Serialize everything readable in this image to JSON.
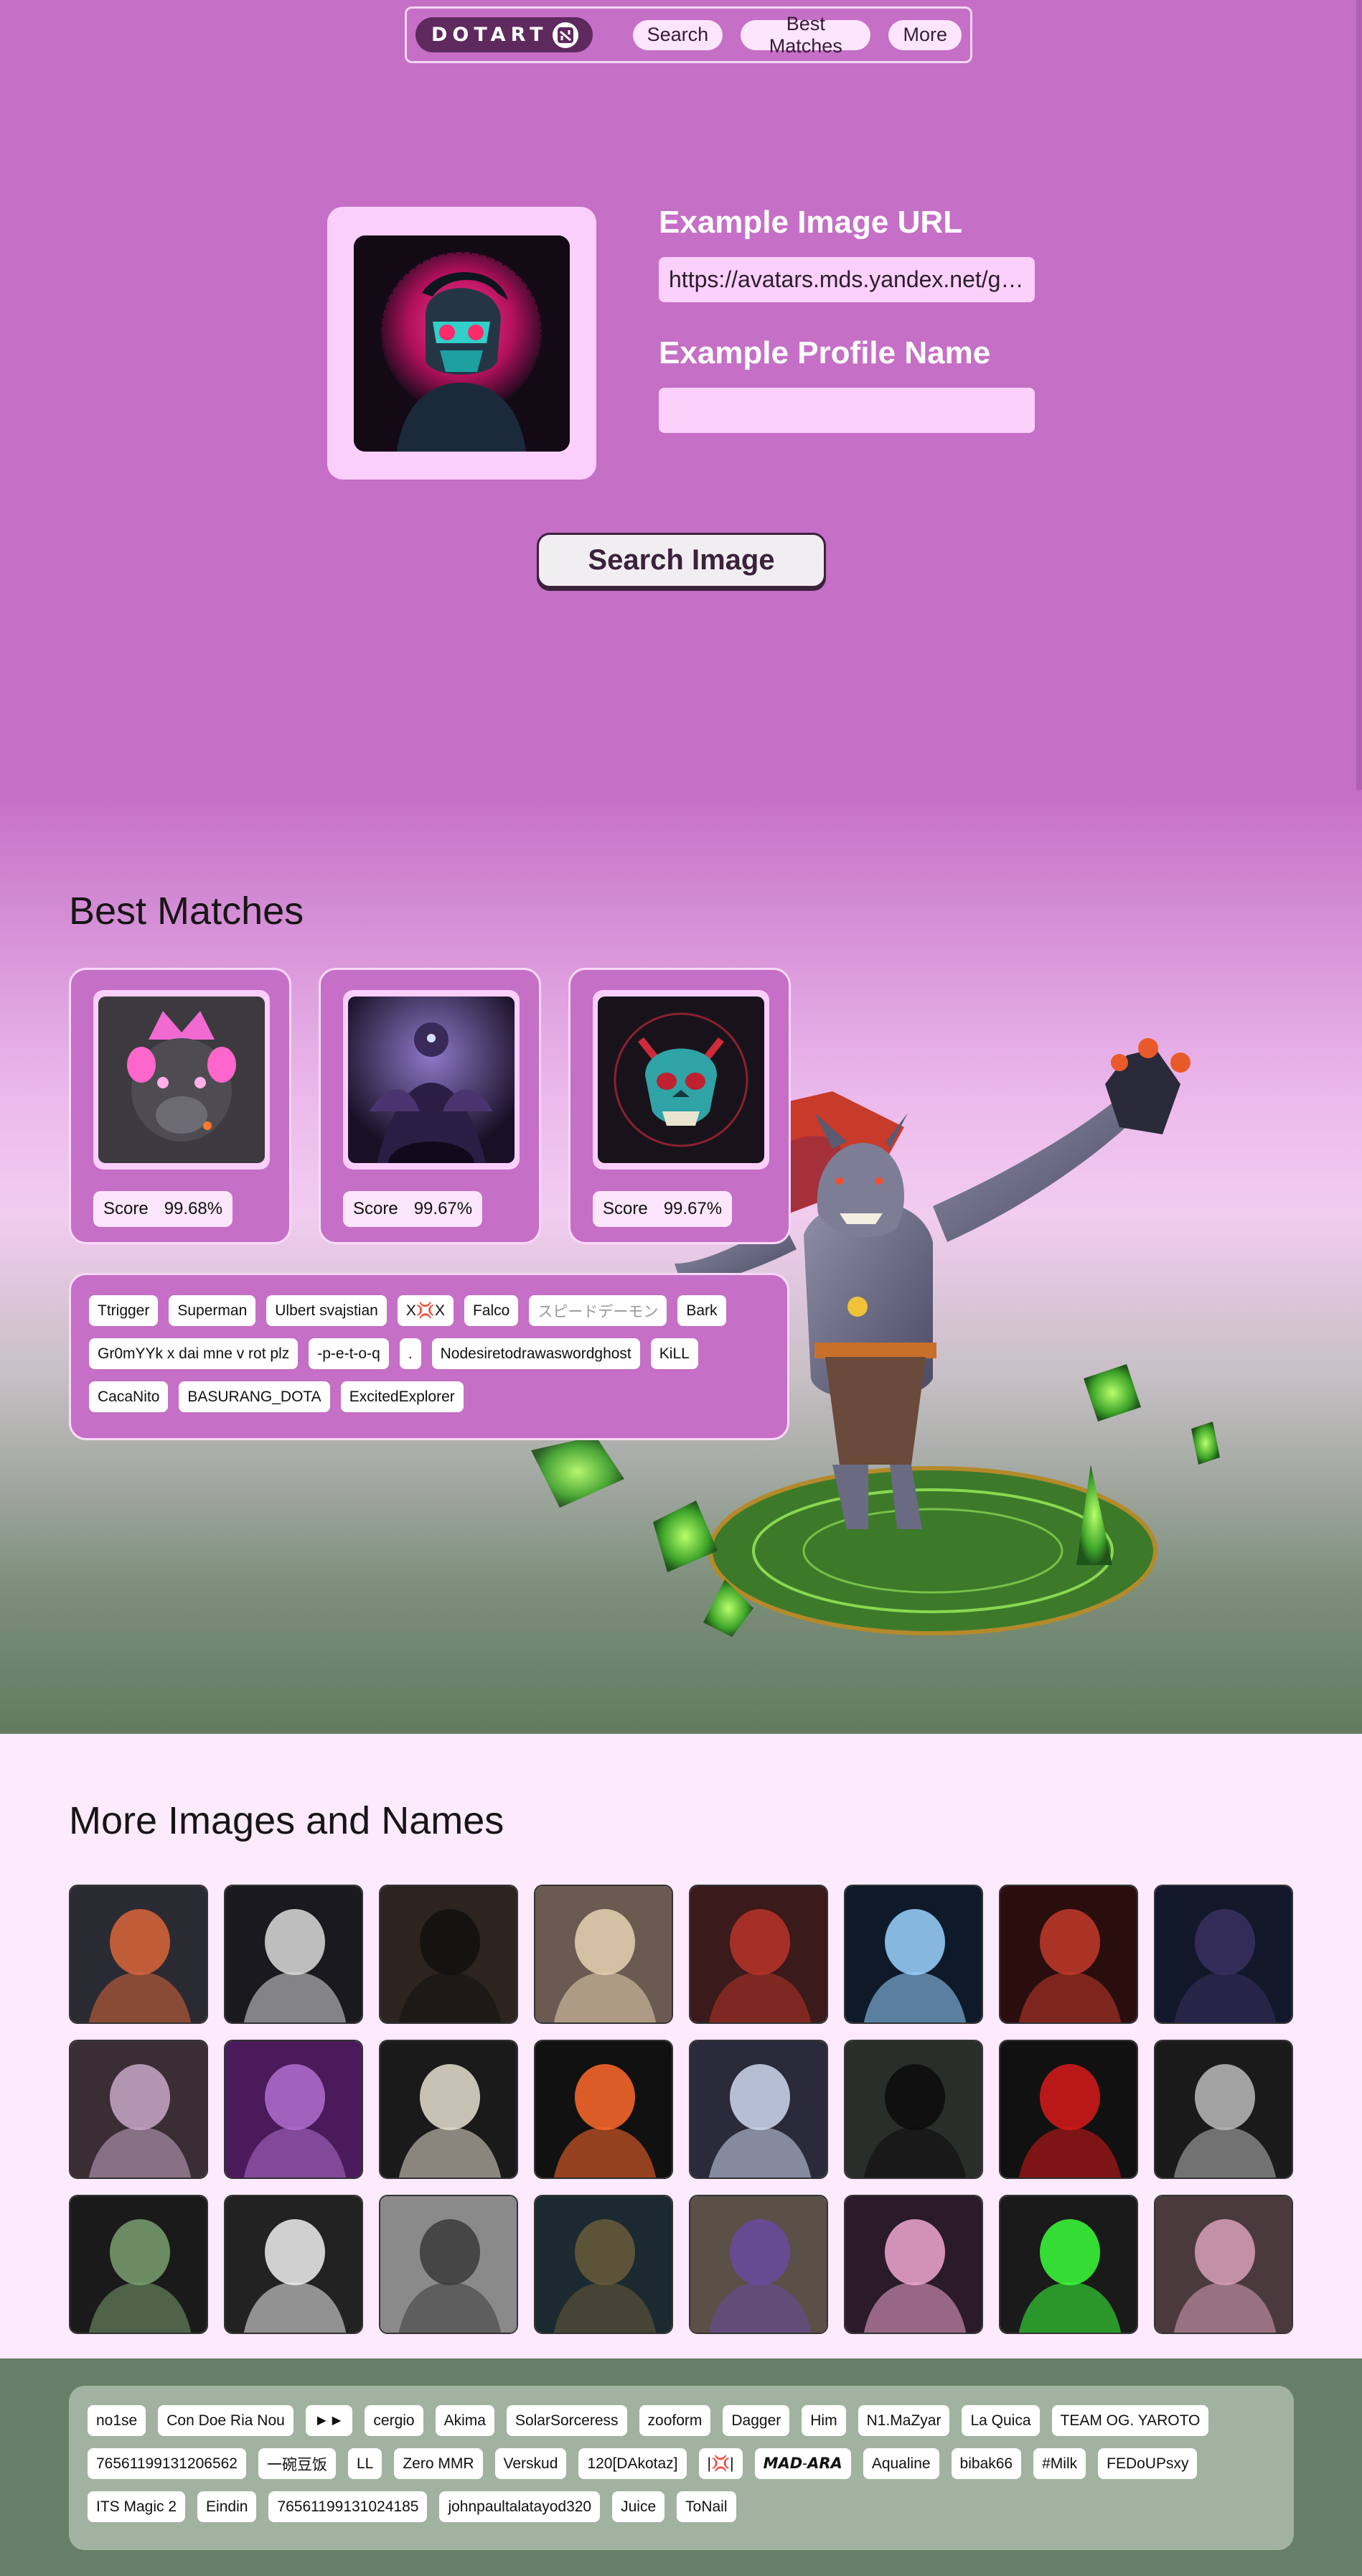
{
  "nav": {
    "logo_text": "DOTART",
    "links": [
      "Search",
      "Best Matches",
      "More"
    ]
  },
  "search": {
    "image_url_label": "Example Image URL",
    "image_url_value": "https://avatars.mds.yandex.net/get-yapic/...",
    "profile_name_label": "Example Profile Name",
    "profile_name_value": "",
    "button_label": "Search Image"
  },
  "best_matches": {
    "title": "Best Matches",
    "score_label": "Score",
    "cards": [
      {
        "score": "99.68%",
        "image": "pink-crowned-bear-avatar"
      },
      {
        "score": "99.67%",
        "image": "purple-void-warrior-avatar"
      },
      {
        "score": "99.67%",
        "image": "teal-demon-skull-avatar"
      }
    ],
    "names": [
      "Ttrigger",
      "Superman",
      "Ulbert svajstian",
      "X💢X",
      "Falco",
      "スピードデーモン",
      "Bark",
      "Gr0mYYk x dai mne v rot plz",
      "-p-e-t-o-q",
      ".",
      "Nodesiretodrawaswordghost",
      "KiLL",
      "CacaNito",
      "BASURANG_DOTA",
      "ExcitedExplorer"
    ],
    "hero_image": "dota-hero-dark-creature"
  },
  "more": {
    "title": "More Images and Names",
    "thumbnails": [
      "redhead-woman-photo",
      "white-haired-figure",
      "sunglasses-boy",
      "blonde-hair-photo",
      "tattooed-chest",
      "white-haired-anime-armor",
      "red-helmet-monster",
      "dark-hair-anime-man",
      "scarred-anime-girl",
      "purple-gas-mask",
      "toasting-gentleman",
      "glowing-eye-skull",
      "nun-anime-girl",
      "hooded-shadow",
      "red-skull-emblem",
      "silver-alien-mask",
      "green-badge-emblem",
      "panda-sunglasses",
      "grey-hoodie-man",
      "chimp-portrait",
      "suited-men-cartoon",
      "pink-hair-anime-girl",
      "green-glitch-monster",
      "pink-hair-woman"
    ],
    "names": [
      "no1se",
      "Con Doe Ria Nou",
      "►►",
      "cergio",
      "Akima",
      "SolarSorceress",
      "zooform",
      "Dagger",
      "Him",
      "N1.MaZyar",
      "La Quica",
      "TEAM OG. YAROTO",
      "76561199131206562",
      "一碗豆饭",
      "LL",
      "Zero MMR",
      "Verskud",
      "120[DAkotaz]",
      "|💢|",
      "𝙈𝘼𝘿-𝘼𝙍𝘼",
      "Aqualine",
      "bibak66",
      "#Milk",
      "FEDoUPsxy",
      "ITS Magic 2",
      "Eindin",
      "76561199131024185",
      "johnpaultalatayod320",
      "Juice",
      "ToNail"
    ]
  }
}
